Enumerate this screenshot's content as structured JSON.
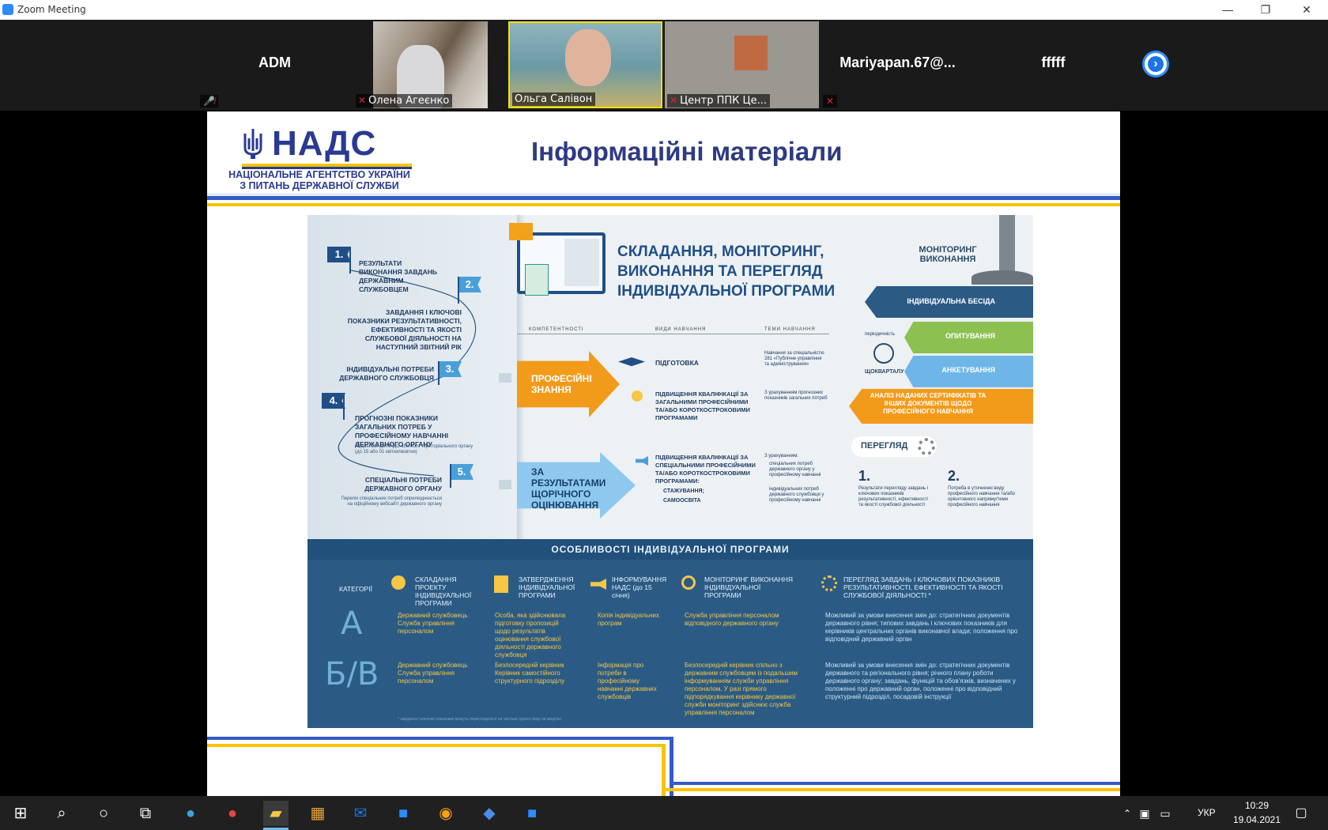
{
  "window": {
    "title": "Zoom Meeting",
    "minimize": "—",
    "restore": "❐",
    "close": "✕"
  },
  "participants": [
    {
      "name": "ADM",
      "type": "name-only"
    },
    {
      "name": "Олена Агеєнко",
      "type": "video"
    },
    {
      "name": "Ольга Салівон",
      "type": "video",
      "active_speaker": true
    },
    {
      "name": "Центр ППК Це...",
      "type": "video"
    },
    {
      "name": "Mariyapan.67@...",
      "type": "name-only"
    },
    {
      "name": "fffff",
      "type": "name-only"
    }
  ],
  "slide": {
    "logo": {
      "abbr": "НАДС",
      "line1": "НАЦІОНАЛЬНЕ АГЕНТСТВО УКРАЇНИ",
      "line2": "З ПИТАНЬ ДЕРЖАВНОЇ СЛУЖБИ"
    },
    "title": "Інформаційні матеріали",
    "infographic": {
      "heading": [
        "СКЛАДАННЯ, МОНІТОРИНГ,",
        "ВИКОНАННЯ ТА ПЕРЕГЛЯД",
        "ІНДИВІДУАЛЬНОЇ ПРОГРАМИ"
      ],
      "steps": [
        {
          "n": "1.",
          "text": "РЕЗУЛЬТАТИ ВИКОНАННЯ ЗАВДАНЬ ДЕРЖАВНИМ СЛУЖБОВЦЕМ"
        },
        {
          "n": "2.",
          "text": "ЗАВДАННЯ І КЛЮЧОВІ ПОКАЗНИКИ РЕЗУЛЬТАТИВНОСТІ, ЕФЕКТИВНОСТІ ТА ЯКОСТІ СЛУЖБОВОЇ ДІЯЛЬНОСТІ НА НАСТУПНИЙ ЗВІТНИЙ РІК"
        },
        {
          "n": "3.",
          "text": "ІНДИВІДУАЛЬНІ ПОТРЕБИ ДЕРЖАВНОГО СЛУЖБОВЦЯ"
        },
        {
          "n": "4.",
          "text": "ПРОГНОЗНІ ПОКАЗНИКИ ЗАГАЛЬНИХ ПОТРЕБ У ПРОФЕСІЙНОМУ НАВЧАННІ ДЕРЖАВНОГО ОРГАНУ",
          "note": "Подається до НАДС або його територіального органу (до 15 або 01 квітня/жовтня)"
        },
        {
          "n": "5.",
          "text": "СПЕЦІАЛЬНІ ПОТРЕБИ ДЕРЖАВНОГО ОРГАНУ",
          "note": "Перелік спеціальних потреб оприлюднюється на офіційному вебсайті державного органу"
        }
      ],
      "columns": [
        "КОМПЕТЕНТНОСТІ",
        "ВИДИ НАВЧАННЯ",
        "ТЕМИ НАВЧАННЯ"
      ],
      "arrows": [
        {
          "label": "ПРОФЕСІЙНІ ЗНАННЯ"
        },
        {
          "label": "ЗА РЕЗУЛЬТАТАМИ ЩОРІЧНОГО ОЦІНЮВАННЯ"
        }
      ],
      "training": {
        "prep": "ПІДГОТОВКА",
        "prep_topic": "Навчання за спеціальністю 281 «Публічне управління та адміністрування»",
        "general": "ПІДВИЩЕННЯ КВАЛІФІКАЦІЇ ЗА ЗАГАЛЬНИМИ ПРОФЕСІЙНИМИ ТА/АБО КОРОТКОСТРОКОВИМИ ПРОГРАМАМИ",
        "general_topic": "З урахуванням прогнозних показників загальних потреб",
        "special": "ПІДВИЩЕННЯ КВАЛІФІКАЦІЇ ЗА СПЕЦІАЛЬНИМИ ПРОФЕСІЙНИМИ ТА/АБО КОРОТКОСТРОКОВИМИ ПРОГРАМАМИ:",
        "special_items": [
          "СТАЖУВАННЯ;",
          "САМООСВІТА"
        ],
        "special_topic": [
          "З урахуванням:",
          "спеціальних потреб державного органу у професійному навчанні",
          "індивідуальних потреб державного службовця у професійному навчанні"
        ]
      },
      "monitoring": {
        "title": "МОНІТОРИНГ ВИКОНАННЯ",
        "periodicity": "періодичність",
        "quarterly": "ЩОКВАРТАЛУ",
        "items": [
          "ІНДИВІДУАЛЬНА БЕСІДА",
          "ОПИТУВАННЯ",
          "АНКЕТУВАННЯ",
          "АНАЛІЗ НАДАНИХ СЕРТИФІКАТІВ ТА ІНШИХ ДОКУМЕНТІВ ЩОДО ПРОФЕСІЙНОГО НАВЧАННЯ"
        ]
      },
      "review": {
        "title": "ПЕРЕГЛЯД",
        "items": [
          {
            "n": "1.",
            "text": "Результати перегляду завдань і ключових показників результативності, ефективності та якості службової діяльності"
          },
          {
            "n": "2.",
            "text": "Потреба в уточненні виду професійного навчання та/або орієнтовного напряму/теми професійного навчання"
          }
        ]
      },
      "features": {
        "title": "ОСОБЛИВОСТІ ІНДИВІДУАЛЬНОЇ ПРОГРАМИ",
        "category_header": "КАТЕГОРІЇ",
        "headers": [
          "СКЛАДАННЯ ПРОЕКТУ ІНДИВІДУАЛЬНОЇ ПРОГРАМИ",
          "ЗАТВЕРДЖЕННЯ ІНДИВІДУАЛЬНОЇ ПРОГРАМИ",
          "ІНФОРМУВАННЯ НАДС (до 15 січня)",
          "МОНІТОРИНГ ВИКОНАННЯ ІНДИВІДУАЛЬНОЇ ПРОГРАМИ",
          "ПЕРЕГЛЯД ЗАВДАНЬ І КЛЮЧОВИХ ПОКАЗНИКІВ РЕЗУЛЬТАТИВНОСТІ, ЕФЕКТИВНОСТІ ТА ЯКОСТІ СЛУЖБОВОЇ ДІЯЛЬНОСТІ *"
        ],
        "rows": [
          {
            "category": "А",
            "cells": [
              "Державний службовець Служба управління персоналом",
              "Особа, яка здійснювала підготовку пропозицій щодо результатів оцінювання службової діяльності державного службовця",
              "Копія індивідуальних програм",
              "Служба управління персоналом відповідного державного органу",
              "Можливий за умови внесення змін до: стратегічних документів державного рівня; типових завдань і ключових показників для керівників центральних органів виконавчої влади; положення про відповідний державний орган"
            ]
          },
          {
            "category": "Б/В",
            "cells": [
              "Державний службовець Служба управління персоналом",
              "Безпосередній керівник Керівник самостійного структурного підрозділу",
              "Інформація про потреби в професійному навчанні державних службовців",
              "Безпосередній керівник спільно з державним службовцем із подальшим інформуванням служби управління персоналом. У разі прямого підпорядкування керівнику державної служби моніторинг здійснює служба управління персоналом",
              "Можливий за умови внесення змін до: стратегічних документів державного та регіонального рівня; річного плану роботи державного органу; завдань, функцій та обов'язків, визначених у положенні про державний орган, положенні про відповідний структурний підрозділ, посадовій інструкції"
            ]
          }
        ],
        "footnote": "* завдання і ключові показники можуть переглядатися не частіше одного разу на квартал"
      }
    }
  },
  "taskbar": {
    "language": "УКР",
    "time": "10:29",
    "date": "19.04.2021"
  },
  "colors": {
    "zoom_blue": "#2d8cff",
    "nads_blue": "#2a3a92",
    "nads_yellow": "#f7c400",
    "active_speaker": "#f5e000"
  }
}
